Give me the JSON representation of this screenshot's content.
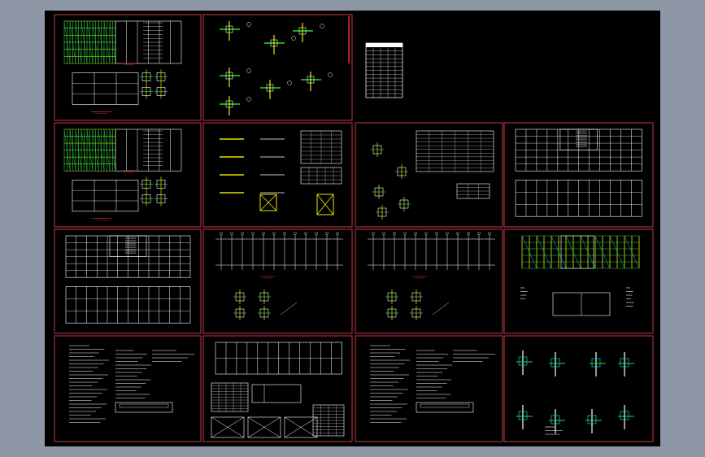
{
  "viewer": {
    "background_color": "#8e97a5",
    "canvas_color": "#000000",
    "frame_color": "#c23a4a"
  },
  "sheets": [
    {
      "id": "s1",
      "kind": "elevation-plan"
    },
    {
      "id": "s2",
      "kind": "node-details"
    },
    {
      "id": "s3",
      "kind": "table-small"
    },
    {
      "id": "s4",
      "kind": "elevation-plan"
    },
    {
      "id": "s5",
      "kind": "member-sections"
    },
    {
      "id": "s6",
      "kind": "node-details-tables"
    },
    {
      "id": "s7",
      "kind": "elevation-grid"
    },
    {
      "id": "s8",
      "kind": "grid-plan-details"
    },
    {
      "id": "s9",
      "kind": "grid-plan-details"
    },
    {
      "id": "s10",
      "kind": "elevation-grid"
    },
    {
      "id": "s11",
      "kind": "elevation-yellow"
    },
    {
      "id": "s12",
      "kind": "notes"
    },
    {
      "id": "s13",
      "kind": "grid-tables-bracing"
    },
    {
      "id": "s14",
      "kind": "notes"
    },
    {
      "id": "s15",
      "kind": "connection-details"
    }
  ]
}
